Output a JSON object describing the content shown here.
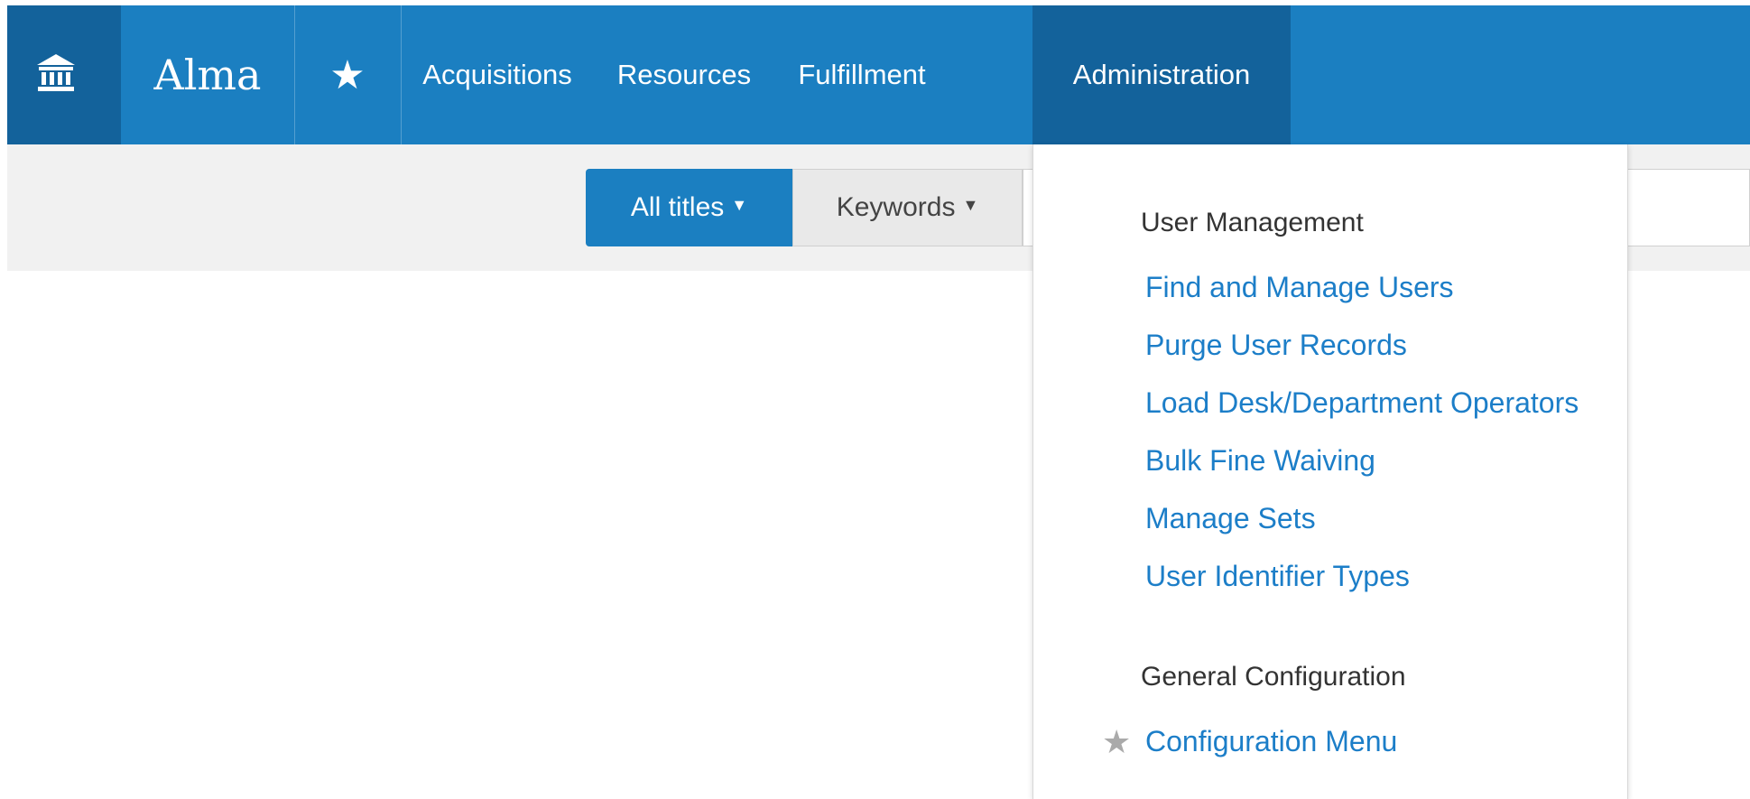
{
  "header": {
    "app_name": "Alma",
    "nav": [
      "Acquisitions",
      "Resources",
      "Fulfillment",
      "Administration"
    ]
  },
  "search": {
    "scope": "All titles",
    "field": "Keywords",
    "query": ""
  },
  "dropdown": {
    "sections": [
      {
        "title": "User Management",
        "items": [
          "Find and Manage Users",
          "Purge User Records",
          "Load Desk/Department Operators",
          "Bulk Fine Waiving",
          "Manage Sets",
          "User Identifier Types"
        ]
      },
      {
        "title": "General Configuration",
        "items": [
          "Configuration Menu"
        ]
      }
    ]
  },
  "colors": {
    "brand_blue": "#1b7fc1",
    "active_blue": "#13629b",
    "link_blue": "#1c7ec8",
    "search_bg": "#f1f1f1"
  },
  "icons": {
    "home": "institution-icon",
    "favorites": "star-icon",
    "dropdown_caret": "caret-down-icon",
    "menu_favorite": "star-outline-icon"
  }
}
